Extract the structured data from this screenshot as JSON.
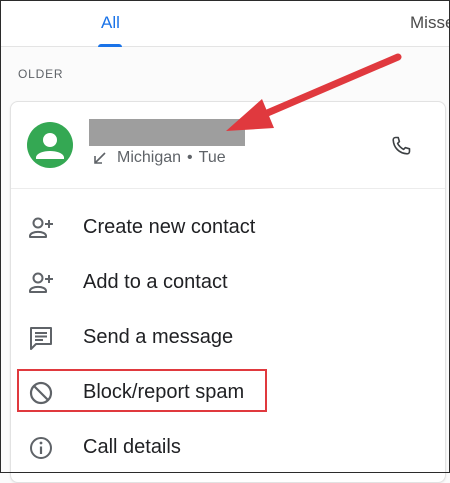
{
  "tabs": [
    {
      "label": "All",
      "active": true
    },
    {
      "label": "Missed",
      "active": false
    }
  ],
  "section_label": "OLDER",
  "call_entry": {
    "name": "",
    "location": "Michigan",
    "separator": "•",
    "day": "Tue",
    "direction_icon": "incoming-call-arrow-icon",
    "action_icon": "phone-icon",
    "avatar_color": "#34a853"
  },
  "menu": {
    "items": [
      {
        "label": "Create new contact",
        "icon": "person-add-icon"
      },
      {
        "label": "Add to a contact",
        "icon": "person-add-icon"
      },
      {
        "label": "Send a message",
        "icon": "message-icon"
      },
      {
        "label": "Block/report spam",
        "icon": "block-icon"
      },
      {
        "label": "Call details",
        "icon": "info-icon"
      }
    ]
  },
  "colors": {
    "accent": "#1a73e8",
    "highlight": "#e0393e",
    "icon": "#5f6368"
  }
}
